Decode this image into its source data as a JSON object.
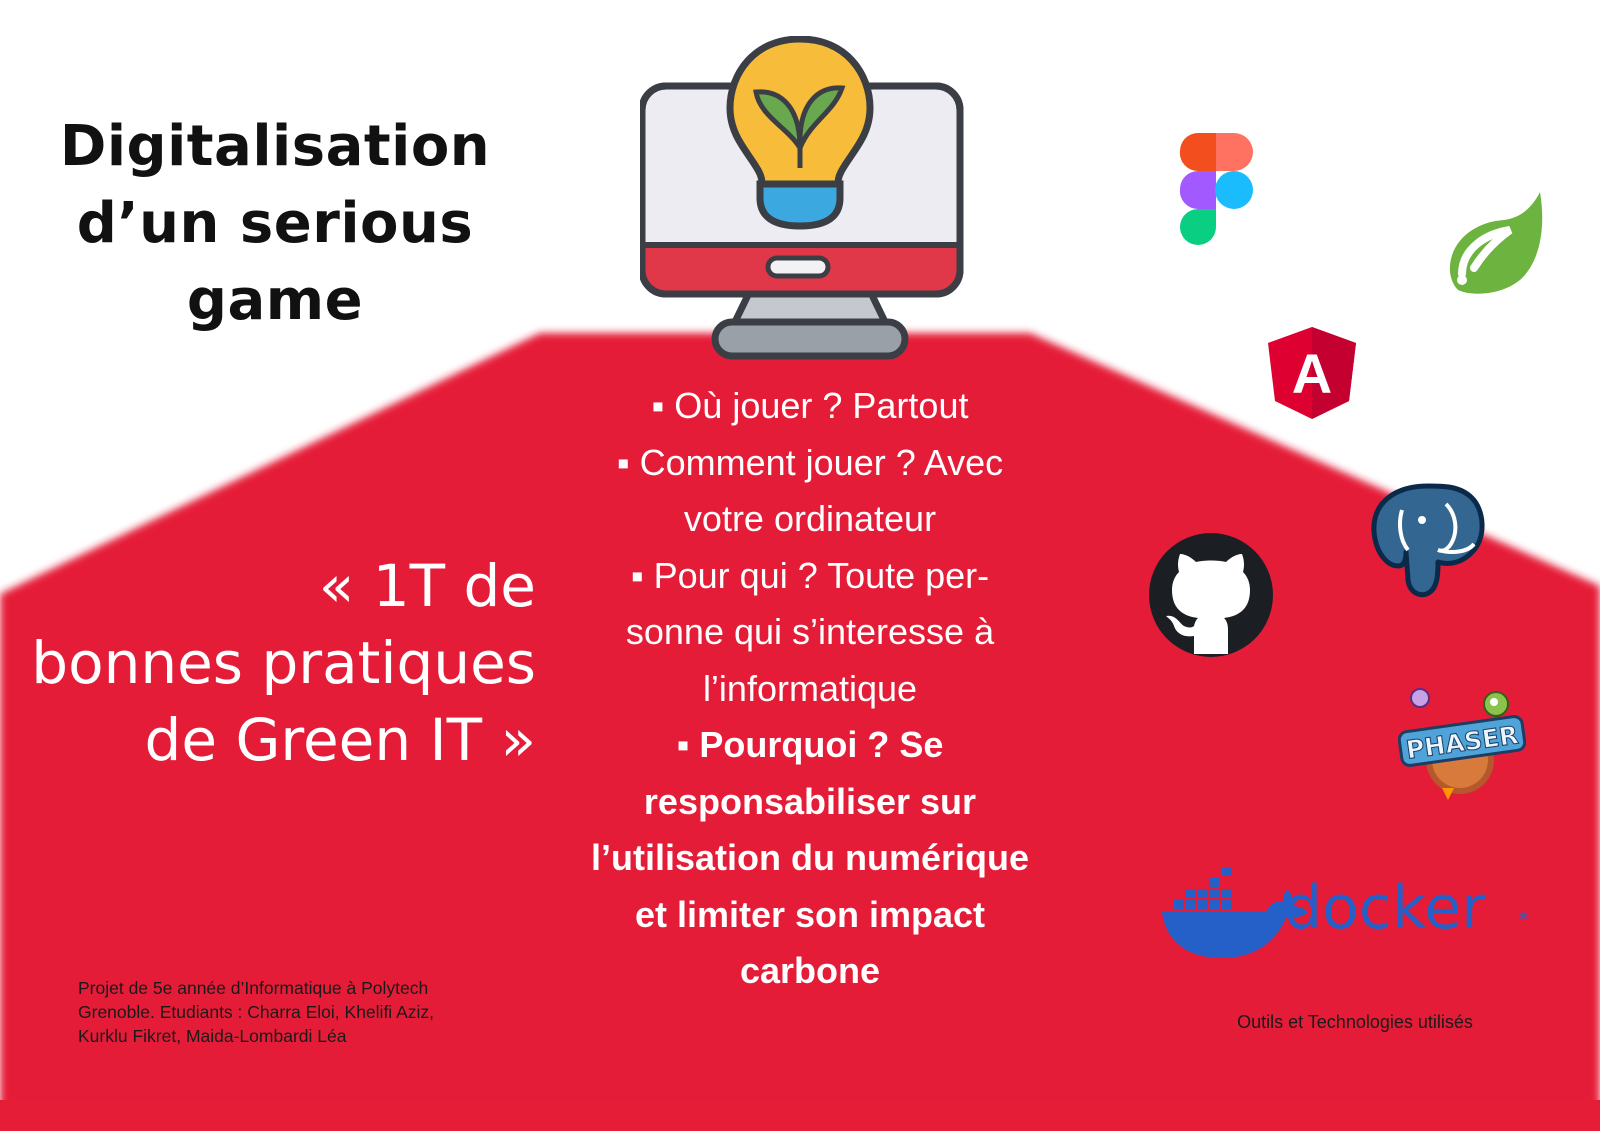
{
  "title": {
    "line1": "Digitalisation",
    "line2": "d’un  serious",
    "line3": "game"
  },
  "quote": {
    "line1": "« 1T de",
    "line2": "bonnes pratiques",
    "line3": "de Green IT »"
  },
  "bullets": [
    {
      "lines": [
        "▪ Où jouer ? Partout"
      ]
    },
    {
      "lines": [
        "▪ Comment jouer ? Avec",
        "votre ordinateur"
      ]
    },
    {
      "lines": [
        "▪ Pour qui ? Toute per-",
        "sonne qui s’interesse à",
        "l’informatique"
      ]
    },
    {
      "lines": [
        "▪ Pourquoi ? Se",
        "responsabiliser sur",
        "l’utilisation du numérique",
        "et limiter son impact",
        "carbone"
      ]
    }
  ],
  "credits": {
    "line1": "Projet de 5e année d’Informatique à Polytech",
    "line2": "Grenoble. Etudiants : Charra Eloi, Khelifi Aziz,",
    "line3": "Kurklu Fikret, Maida-Lombardi Léa"
  },
  "tools_caption": "Outils et Technologies utilisés",
  "logos": {
    "angular_letter": "A",
    "phaser_word": "PHASER",
    "docker_word": "docker",
    "docker_mark": "®"
  },
  "icons": [
    "computer-lightbulb-icon",
    "figma-icon",
    "spring-icon",
    "angular-icon",
    "postgresql-icon",
    "github-icon",
    "phaser-icon",
    "docker-icon"
  ],
  "colors": {
    "red": "#e51d37",
    "text_dark": "#111111",
    "white": "#ffffff",
    "docker_blue": "#2560c8",
    "spring_green": "#6db33f",
    "angular_red": "#dd0031",
    "postgres_blue": "#336791"
  }
}
